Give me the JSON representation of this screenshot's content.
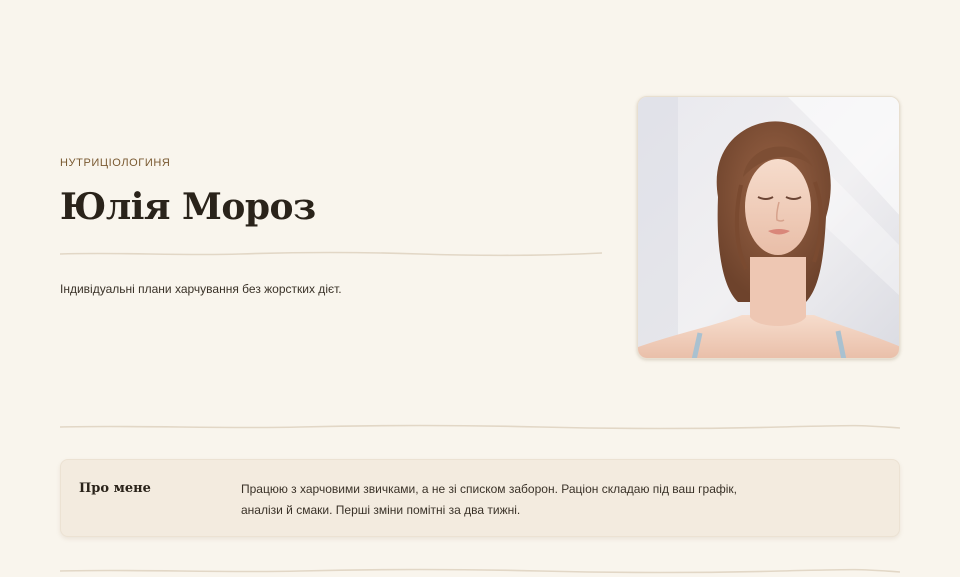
{
  "profile": {
    "role": "НУТРИЦІОЛОГИНЯ",
    "name": "Юлія Мороз",
    "tagline": "Індивідуальні плани харчування без жорстких дієт."
  },
  "about": {
    "title": "Про мене",
    "text": "Працюю з харчовими звичками, а не зі списком заборон. Раціон складаю під ваш графік, аналізи й смаки. Перші зміни помітні за два тижні."
  },
  "colors": {
    "background": "#f9f5ed",
    "card": "#f3ebdf",
    "accent": "#7a5a32",
    "divider": "#e2d7c6"
  }
}
